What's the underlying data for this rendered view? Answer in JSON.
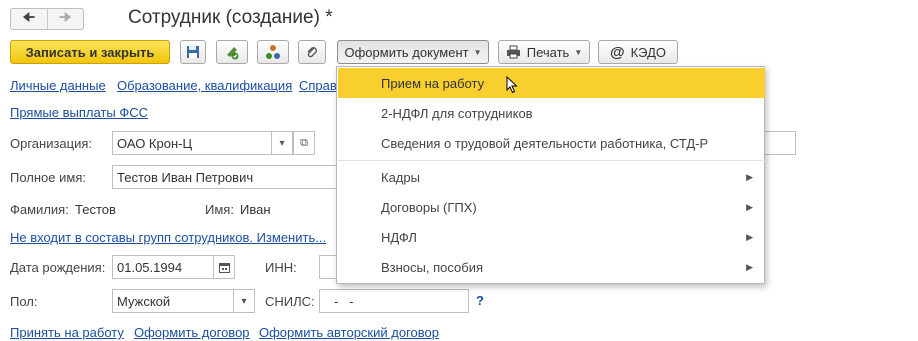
{
  "nav": {
    "back_icon": "arrow-left-icon",
    "forward_icon": "arrow-right-icon"
  },
  "title": "Сотрудник (создание) *",
  "toolbar": {
    "save_close_label": "Записать и закрыть",
    "format_doc_label": "Оформить документ",
    "print_label": "Печать",
    "kedo_label": "КЭДО"
  },
  "links_row1": [
    "Личные данные",
    "Образование, квалификация",
    "Справ"
  ],
  "fss_link": "Прямые выплаты ФСС",
  "org": {
    "label": "Организация:",
    "value": "ОАО Крон-Ц"
  },
  "fullname": {
    "label": "Полное имя:",
    "value": "Тестов Иван Петрович"
  },
  "surname": {
    "label": "Фамилия:",
    "value": "Тестов"
  },
  "name": {
    "label": "Имя:",
    "value": "Иван"
  },
  "groups_link": "Не входит в составы групп сотрудников. Изменить...",
  "birth": {
    "label": "Дата рождения:",
    "value": "01.05.1994"
  },
  "inn": {
    "label": "ИНН:",
    "value": ""
  },
  "gender": {
    "label": "Пол:",
    "value": "Мужской"
  },
  "snils": {
    "label": "СНИЛС:",
    "value": "-   -",
    "help": "?"
  },
  "bottom_links": [
    "Принять на работу",
    "Оформить договор",
    "Оформить авторский договор"
  ],
  "menu": {
    "items": [
      {
        "label": "Прием на работу",
        "highlighted": true,
        "submenu": false
      },
      {
        "label": "2-НДФЛ для сотрудников",
        "highlighted": false,
        "submenu": false
      },
      {
        "label": "Сведения о трудовой деятельности работника, СТД-Р",
        "highlighted": false,
        "submenu": false
      },
      {
        "label": "Кадры",
        "highlighted": false,
        "submenu": true
      },
      {
        "label": "Договоры (ГПХ)",
        "highlighted": false,
        "submenu": true
      },
      {
        "label": "НДФЛ",
        "highlighted": false,
        "submenu": true
      },
      {
        "label": "Взносы, пособия",
        "highlighted": false,
        "submenu": true
      }
    ]
  },
  "colors": {
    "accent": "#f2c50d",
    "menu_highlight": "#f8cf2f",
    "link": "#1c4fa0"
  }
}
